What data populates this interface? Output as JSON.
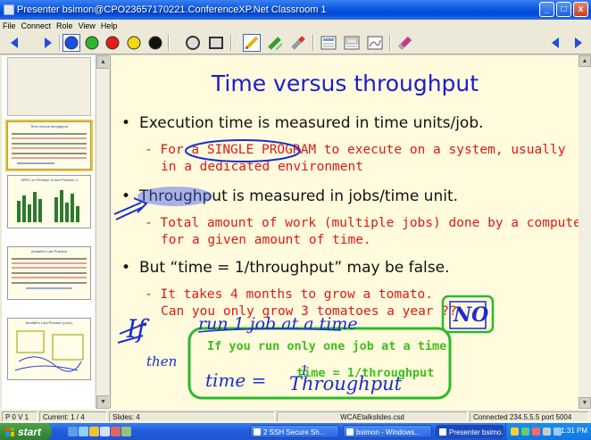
{
  "window": {
    "title": "Presenter   bsimon@CPO23657170221.ConferenceXP.Net   Classroom 1",
    "controls": {
      "minimize": "_",
      "maximize": "□",
      "close": "x"
    }
  },
  "menu": [
    "File",
    "Connect",
    "Role",
    "View",
    "Help"
  ],
  "toolbar": {
    "nav_prev": "previous-slide",
    "nav_next": "next-slide",
    "pen_colors": [
      "#1a4fe8",
      "#2fb52f",
      "#e81c1c",
      "#f5d80f",
      "#111111"
    ],
    "tools": [
      "circle-ink-tool",
      "rectangle-tool",
      "pen-tool",
      "highlighter-tool",
      "eraser-tool",
      "slide-view-1",
      "slide-view-2",
      "slide-view-3",
      "erase-all-tool"
    ]
  },
  "filmstrip": {
    "thumbnails": [
      {
        "title": "Time versus throughput"
      },
      {
        "title": "SPEC on Pentium III and Pentium 4"
      },
      {
        "title": "Amdahl's Law Practice"
      },
      {
        "title": "Amdahl's Law Practice (cont.)"
      }
    ],
    "scroll_up": "▲",
    "scroll_down": "▼"
  },
  "slide": {
    "title": "Time versus throughput",
    "bullets": [
      {
        "text": "Execution time is measured in time units/job."
      },
      {
        "text": "Throughput is measured in jobs/time unit."
      },
      {
        "text": "But “time = 1/throughput” may be false."
      }
    ],
    "sub_bullets": [
      {
        "pre": "For a ",
        "highlight": "SINGLE PROGRAM",
        "post": " to execute on a system, usually",
        "line2": "in a dedicated environment"
      },
      {
        "line1": "Total amount of work (multiple jobs) done by a computer",
        "line2": "for a given amount of time."
      },
      {
        "line1": "It takes 4 months to grow a tomato.",
        "line2": "Can you only grow 3 tomatoes a year ??"
      }
    ],
    "bullet_char": "•",
    "sub_char": "-",
    "ink": {
      "no": "NO",
      "if_line1": "If",
      "run_job": "run 1 job at a time",
      "then": "then",
      "time_eq": "time =",
      "one": "1",
      "throughput": "Throughput"
    },
    "typed_note": {
      "line1": "If you run only one job at a time,",
      "line2": "time = 1/throughput"
    }
  },
  "statusbar": {
    "version": "P 0 V 1",
    "current": "Current: 1 / 4",
    "slides": "Slides: 4",
    "file": "WCAEtalkslides.csd",
    "connection": "Connected 234.5.5.5 port 5004"
  },
  "taskbar": {
    "start": "start",
    "tasks": [
      {
        "label": "2 SSH Secure Sh...",
        "active": false
      },
      {
        "label": "bsimon - Windows...",
        "active": false
      },
      {
        "label": "Presenter   bsimo...",
        "active": true
      }
    ],
    "clock": "1:31 PM"
  }
}
